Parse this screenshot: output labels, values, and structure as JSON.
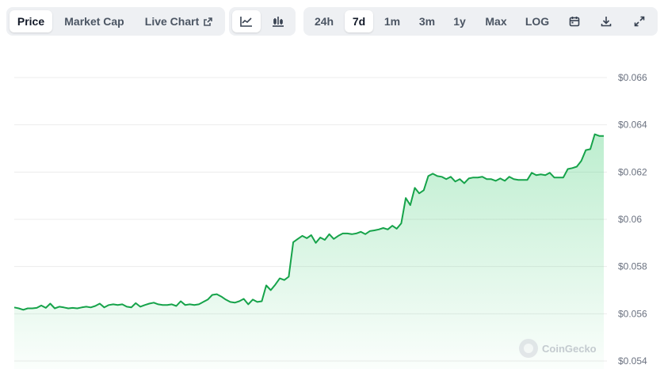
{
  "tabs": {
    "price": "Price",
    "market_cap": "Market Cap",
    "live_chart": "Live Chart"
  },
  "chart_types": [
    "line-chart-icon",
    "candlestick-chart-icon"
  ],
  "ranges": [
    "24h",
    "7d",
    "1m",
    "3m",
    "1y",
    "Max",
    "LOG"
  ],
  "active_range": "7d",
  "active_tab": "Price",
  "icons": {
    "external": "external-link-icon",
    "calendar": "calendar-icon",
    "download": "download-icon",
    "expand": "expand-icon"
  },
  "colors": {
    "line": "#16a34a",
    "fill": "#22c55e",
    "grid": "#ececec",
    "axis_text": "#6b7280"
  },
  "watermark": "CoinGecko",
  "chart_data": {
    "type": "area",
    "title": "",
    "xlabel": "",
    "ylabel": "",
    "ylim": [
      0.054,
      0.066
    ],
    "yticks": [
      0.066,
      0.064,
      0.062,
      0.06,
      0.058,
      0.056,
      0.054
    ],
    "ytick_labels": [
      "$0.066",
      "$0.064",
      "$0.062",
      "$0.06",
      "$0.058",
      "$0.056",
      "$0.054"
    ],
    "grid": true,
    "series": [
      {
        "values": [
          0.05627,
          0.05623,
          0.05617,
          0.05623,
          0.05623,
          0.05625,
          0.05635,
          0.05625,
          0.05643,
          0.05623,
          0.0563,
          0.05627,
          0.05623,
          0.05625,
          0.05623,
          0.05627,
          0.0563,
          0.05627,
          0.05633,
          0.05643,
          0.05627,
          0.05637,
          0.0564,
          0.05637,
          0.0564,
          0.0563,
          0.05627,
          0.05645,
          0.0563,
          0.05637,
          0.05643,
          0.05647,
          0.0564,
          0.05637,
          0.05637,
          0.0564,
          0.05633,
          0.05653,
          0.05637,
          0.0564,
          0.05637,
          0.0564,
          0.0565,
          0.0566,
          0.0568,
          0.05683,
          0.05673,
          0.0566,
          0.0565,
          0.05647,
          0.05653,
          0.05663,
          0.0564,
          0.0566,
          0.0565,
          0.05653,
          0.0572,
          0.057,
          0.05723,
          0.0575,
          0.05743,
          0.05757,
          0.05903,
          0.05917,
          0.0593,
          0.0592,
          0.05933,
          0.059,
          0.05923,
          0.05913,
          0.05937,
          0.05917,
          0.0593,
          0.0594,
          0.0594,
          0.05937,
          0.0594,
          0.05947,
          0.05937,
          0.0595,
          0.05953,
          0.05957,
          0.05963,
          0.05957,
          0.05973,
          0.0596,
          0.05983,
          0.0609,
          0.0606,
          0.06133,
          0.0611,
          0.06123,
          0.06183,
          0.06193,
          0.06183,
          0.0618,
          0.0617,
          0.0618,
          0.0616,
          0.0617,
          0.06153,
          0.06173,
          0.06177,
          0.06177,
          0.0618,
          0.0617,
          0.0617,
          0.06163,
          0.06173,
          0.06163,
          0.0618,
          0.0617,
          0.06167,
          0.06167,
          0.06167,
          0.06197,
          0.06187,
          0.0619,
          0.06187,
          0.06197,
          0.06177,
          0.06177,
          0.06177,
          0.06213,
          0.06217,
          0.06223,
          0.06247,
          0.06293,
          0.06297,
          0.0636,
          0.06353,
          0.06353
        ]
      }
    ]
  }
}
